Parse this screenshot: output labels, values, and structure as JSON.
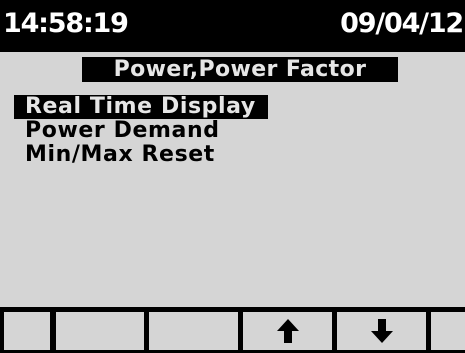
{
  "status_bar": {
    "time": "14:58:19",
    "date": "09/04/12"
  },
  "menu": {
    "title": "Power,Power Factor",
    "items": [
      {
        "label": "Real Time Display",
        "selected": true
      },
      {
        "label": "Power Demand",
        "selected": false
      },
      {
        "label": "Min/Max Reset",
        "selected": false
      }
    ]
  },
  "softkeys": [
    {
      "icon": ""
    },
    {
      "icon": ""
    },
    {
      "icon": ""
    },
    {
      "icon": "arrow-up-icon"
    },
    {
      "icon": "arrow-down-icon"
    },
    {
      "icon": ""
    }
  ],
  "colors": {
    "screen_background": "#d5d5d5",
    "inverse_background": "#000000",
    "inverse_text": "#e6e6e6"
  }
}
